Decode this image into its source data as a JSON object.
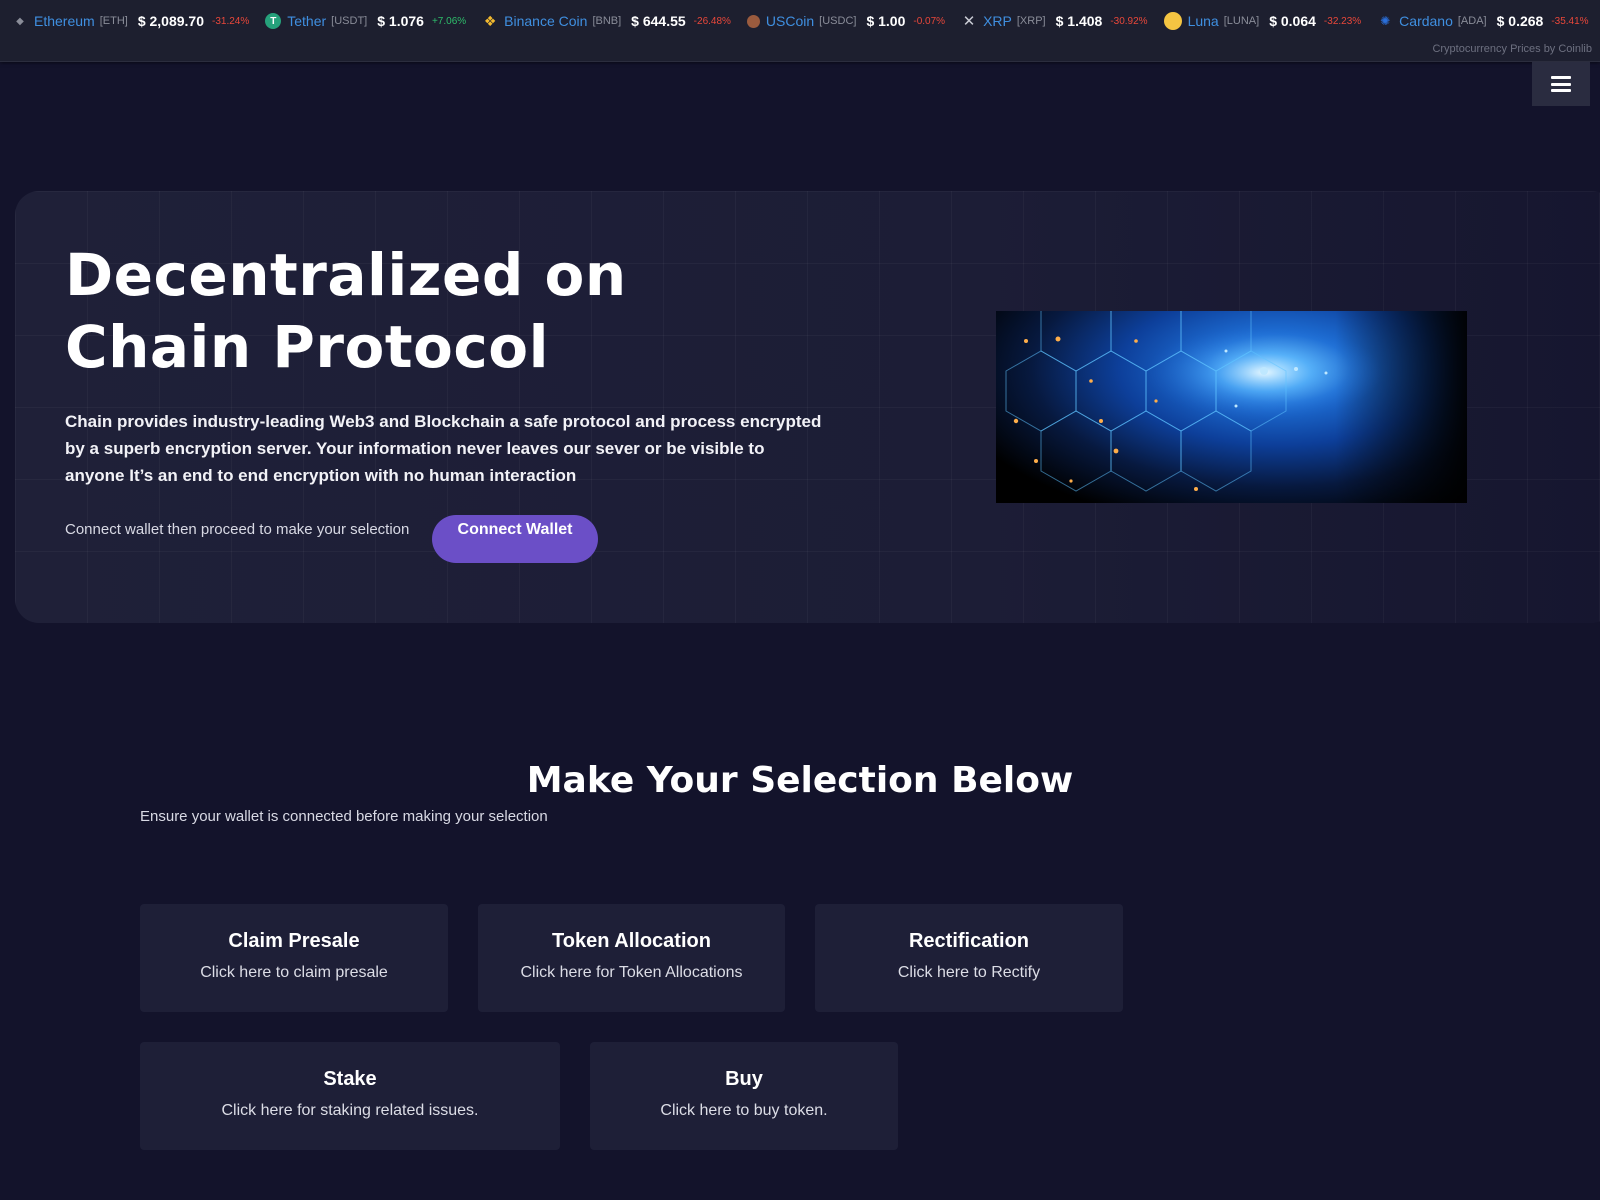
{
  "ticker": {
    "coins": [
      {
        "name": "Ethereum",
        "symbol": "[ETH]",
        "price": "$ 2,089.70",
        "change": "-31.24%",
        "icon": "ethereum-icon",
        "color": "#8a8d99"
      },
      {
        "name": "Tether",
        "symbol": "[USDT]",
        "price": "$ 1.076",
        "change": "+7.06%",
        "icon": "tether-icon",
        "color": "#26a17b"
      },
      {
        "name": "Binance Coin",
        "symbol": "[BNB]",
        "price": "$ 644.55",
        "change": "-26.48%",
        "icon": "binance-icon",
        "color": "#f3ba2f"
      },
      {
        "name": "USCoin",
        "symbol": "[USDC]",
        "price": "$ 1.00",
        "change": "-0.07%",
        "icon": "uscoin-icon",
        "color": "#9a5b3e"
      },
      {
        "name": "XRP",
        "symbol": "[XRP]",
        "price": "$ 1.408",
        "change": "-30.92%",
        "icon": "xrp-icon",
        "color": "#8a8d99"
      },
      {
        "name": "Luna",
        "symbol": "[LUNA]",
        "price": "$ 0.064",
        "change": "-32.23%",
        "icon": "luna-icon",
        "color": "#f5c542"
      },
      {
        "name": "Cardano",
        "symbol": "[ADA]",
        "price": "$ 0.268",
        "change": "-35.41%",
        "icon": "cardano-icon",
        "color": "#2a6fdb"
      }
    ],
    "credit": "Cryptocurrency Prices by Coinlib"
  },
  "hero": {
    "title": "Decentralized on Chain Protocol",
    "description": "Chain provides industry-leading Web3 and Blockchain a safe protocol and process encrypted by a superb encryption server. Your information never leaves our sever or be visible to anyone It’s an end to end encryption with no human interaction",
    "cta_text": "Connect wallet then proceed to make your selection",
    "connect_button": "Connect Wallet"
  },
  "selection": {
    "title": "Make Your Selection Below",
    "subtitle": "Ensure your wallet is connected before making your selection",
    "cards": [
      {
        "title": "Claim Presale",
        "desc": "Click here to claim presale"
      },
      {
        "title": "Token Allocation",
        "desc": "Click here for Token Allocations"
      },
      {
        "title": "Rectification",
        "desc": "Click here to Rectify"
      },
      {
        "title": "Stake",
        "desc": "Click here for staking related issues."
      },
      {
        "title": "Buy",
        "desc": "Click here to buy token."
      }
    ]
  },
  "colors": {
    "background": "#13132b",
    "accent": "#6b4fc7",
    "negative": "#e8473a",
    "positive": "#2ebd6b",
    "link": "#3f8fe0"
  }
}
